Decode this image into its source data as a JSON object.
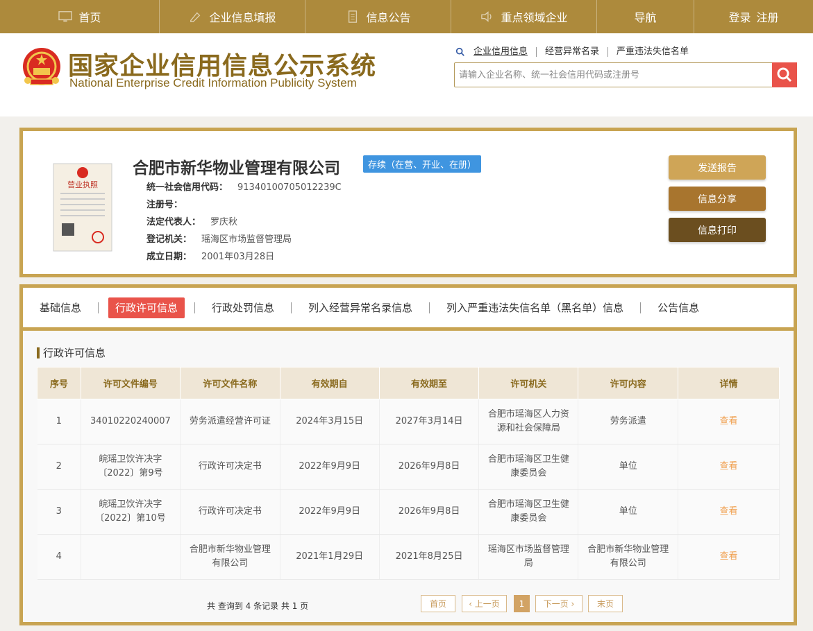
{
  "topnav": {
    "items": [
      {
        "label": "首页",
        "icon": "monitor-icon"
      },
      {
        "label": "企业信息填报",
        "icon": "edit-icon"
      },
      {
        "label": "信息公告",
        "icon": "document-icon"
      },
      {
        "label": "重点领域企业",
        "icon": "speaker-icon"
      },
      {
        "label": "导航",
        "icon": ""
      }
    ],
    "login": "登录",
    "register": "注册"
  },
  "header": {
    "title_cn": "国家企业信用信息公示系统",
    "title_en": "National Enterprise Credit Information Publicity System",
    "search_tabs": [
      "企业信用信息",
      "经营异常名录",
      "严重违法失信名单"
    ],
    "search_placeholder": "请输入企业名称、统一社会信用代码或注册号"
  },
  "company": {
    "name": "合肥市新华物业管理有限公司",
    "status": "存续（在营、开业、在册）",
    "fields": [
      {
        "label": "统一社会信用代码：",
        "value": "91340100705012239C"
      },
      {
        "label": "注册号：",
        "value": ""
      },
      {
        "label": "法定代表人：",
        "value": "罗庆秋"
      },
      {
        "label": "登记机关：",
        "value": "瑶海区市场监督管理局"
      },
      {
        "label": "成立日期：",
        "value": "2001年03月28日"
      }
    ],
    "license_text": "营业执照",
    "actions": [
      "发送报告",
      "信息分享",
      "信息打印"
    ]
  },
  "tabs": {
    "items": [
      "基础信息",
      "行政许可信息",
      "行政处罚信息",
      "列入经营异常名录信息",
      "列入严重违法失信名单（黑名单）信息",
      "公告信息"
    ],
    "active": 1
  },
  "section": {
    "title": "行政许可信息",
    "headers": [
      "序号",
      "许可文件编号",
      "许可文件名称",
      "有效期自",
      "有效期至",
      "许可机关",
      "许可内容",
      "详情"
    ],
    "rows": [
      [
        "1",
        "34010220240007",
        "劳务派遣经营许可证",
        "2024年3月15日",
        "2027年3月14日",
        "合肥市瑶海区人力资源和社会保障局",
        "劳务派遣",
        "查看"
      ],
      [
        "2",
        "皖瑶卫饮许决字〔2022〕第9号",
        "行政许可决定书",
        "2022年9月9日",
        "2026年9月8日",
        "合肥市瑶海区卫生健康委员会",
        "单位",
        "查看"
      ],
      [
        "3",
        "皖瑶卫饮许决字〔2022〕第10号",
        "行政许可决定书",
        "2022年9月9日",
        "2026年9月8日",
        "合肥市瑶海区卫生健康委员会",
        "单位",
        "查看"
      ],
      [
        "4",
        "",
        "合肥市新华物业管理有限公司",
        "2021年1月29日",
        "2021年8月25日",
        "瑶海区市场监督管理局",
        "合肥市新华物业管理有限公司",
        "查看"
      ]
    ]
  },
  "pager": {
    "total": "共 查询到 4 条记录 共 1 页",
    "first": "首页",
    "prev": "‹ 上一页",
    "current": "1",
    "next": "下一页 ›",
    "last": "末页"
  },
  "colors": {
    "gold": "#ad8a3c",
    "border": "#c8a452",
    "red": "#e9534a",
    "blue": "#3f95e0"
  }
}
